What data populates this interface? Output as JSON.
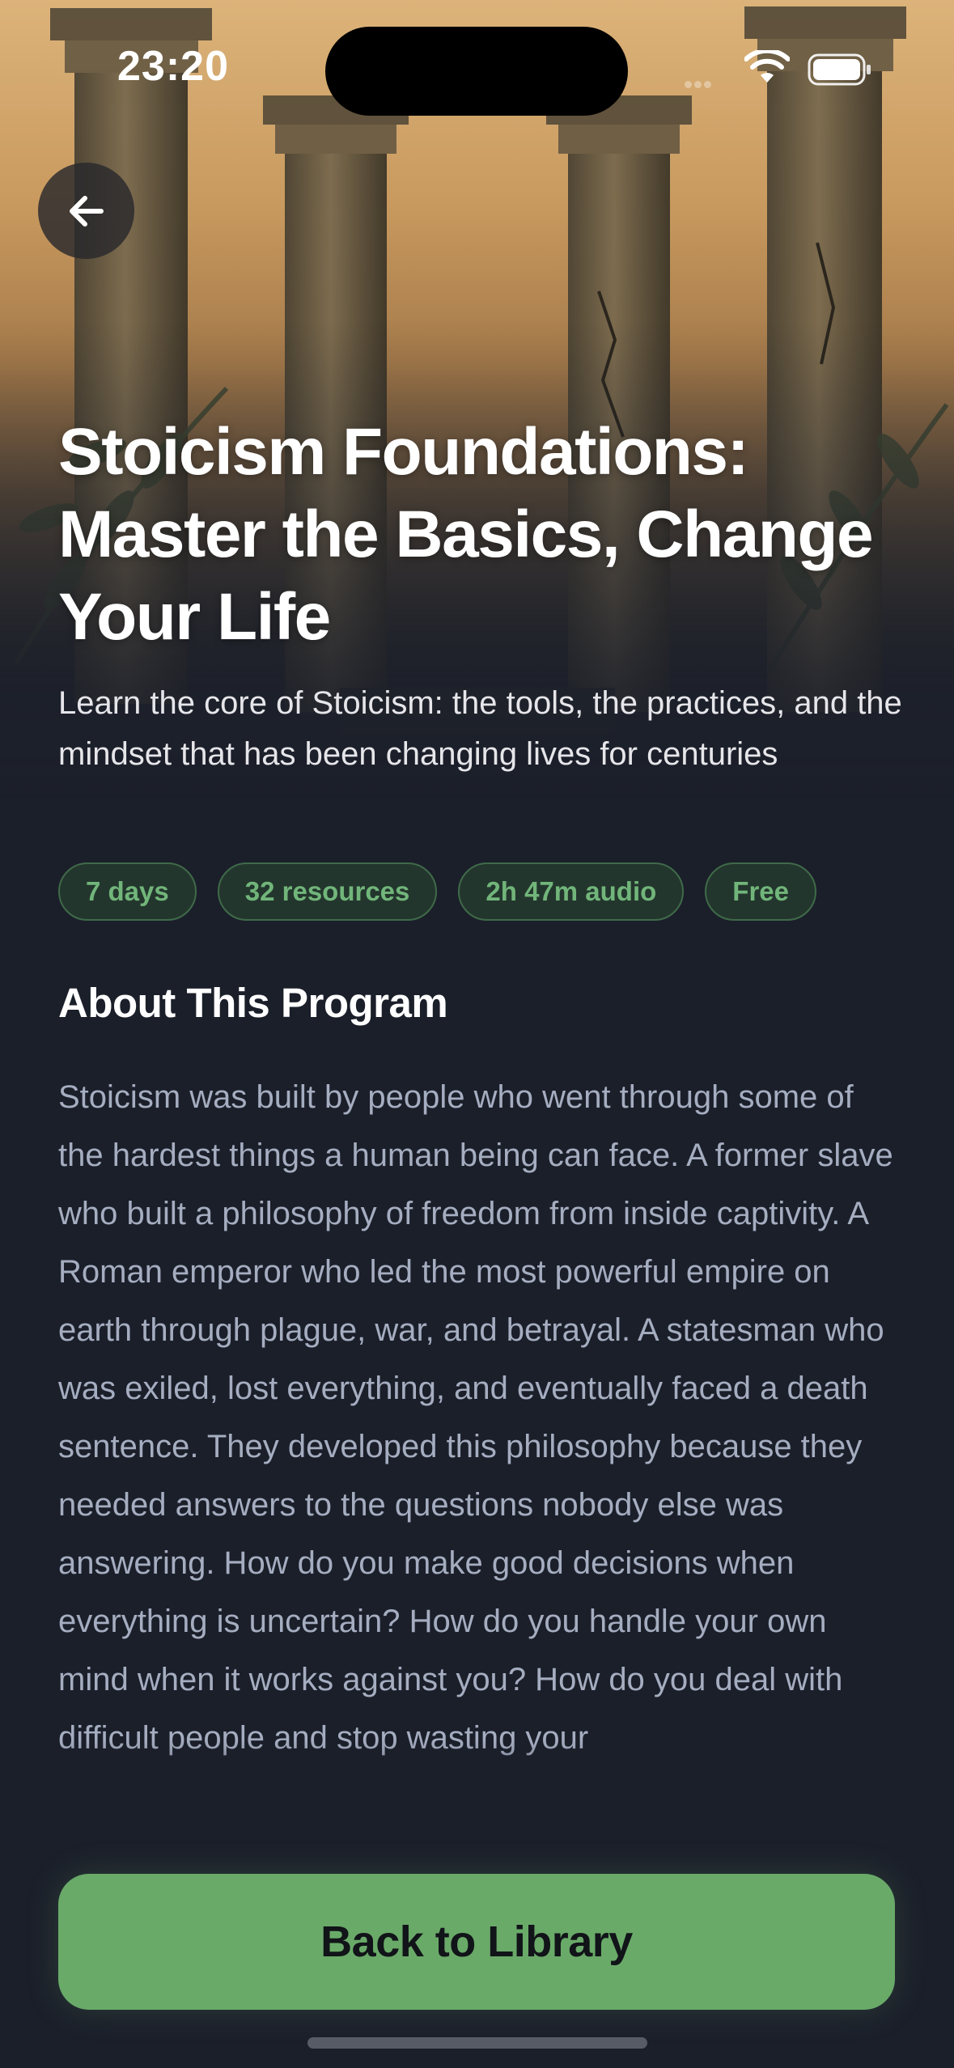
{
  "status_bar": {
    "time": "23:20"
  },
  "hero": {
    "image": "greek-columns-laurel-illustration",
    "back_icon": "arrow-left-icon"
  },
  "program": {
    "title": "Stoicism Foundations: Master the Basics, Change Your Life",
    "subtitle": "Learn the core of Stoicism: the tools, the practices, and the mindset that has been changing lives for centuries",
    "chips": [
      "7 days",
      "32 resources",
      "2h 47m audio",
      "Free"
    ]
  },
  "about": {
    "heading": "About This Program",
    "body": "Stoicism was built by people who went through some of the hardest things a human being can face. A former slave who built a philosophy of freedom from inside captivity. A Roman emperor who led the most powerful empire on earth through plague, war, and betrayal. A statesman who was exiled, lost everything, and eventually faced a death sentence. They developed this philosophy because they needed answers to the questions nobody else was answering. How do you make good decisions when everything is uncertain? How do you handle your own mind when it works against you? How do you deal with difficult people and stop wasting your"
  },
  "cta": {
    "label": "Back to Library"
  },
  "colors": {
    "background": "#1b1f2a",
    "accent_green": "#6aaa69",
    "chip_text": "#71b57a",
    "body_text": "#a5adc0"
  }
}
